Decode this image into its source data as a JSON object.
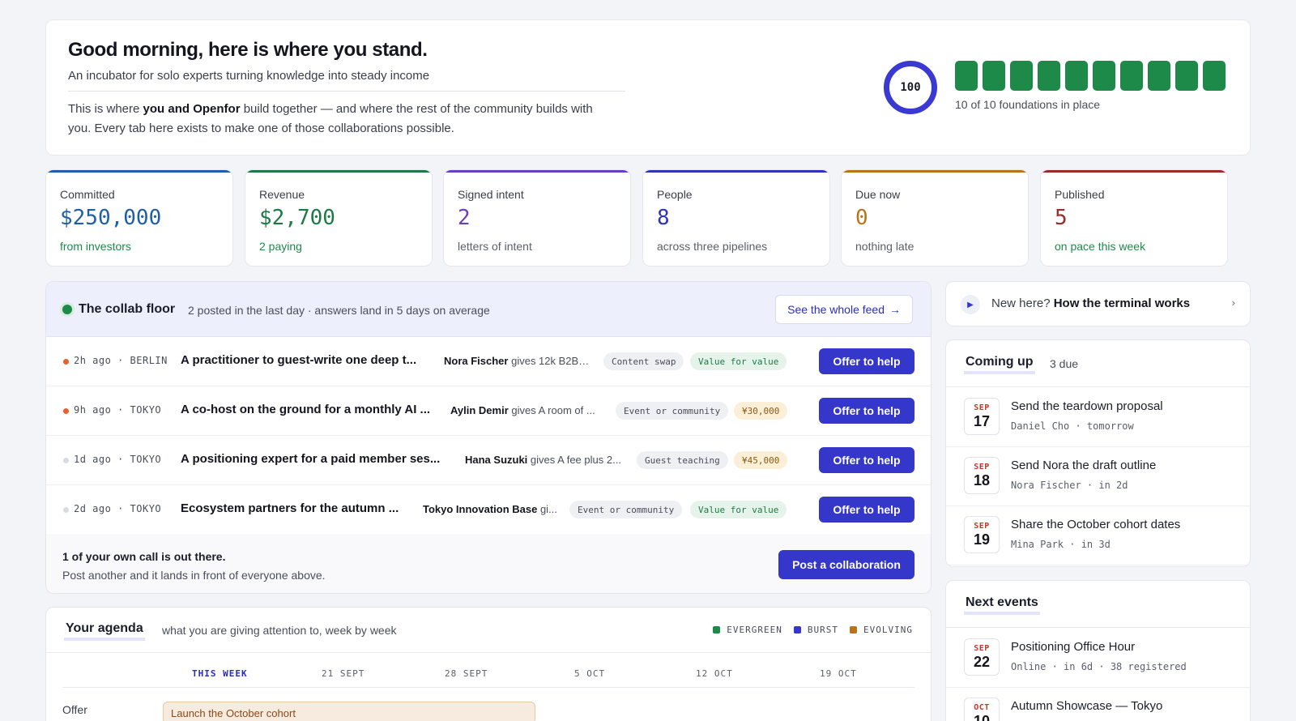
{
  "hero": {
    "title": "Good morning, here is where you stand.",
    "subtitle": "An incubator for solo experts turning knowledge into steady income",
    "body_pre": "This is where ",
    "body_bold": "you and Openfor",
    "body_post": " build together — and where the rest of the community builds with you. Every tab here exists to make one of those collaborations possible.",
    "score": "100",
    "foundations_done": 10,
    "foundations_total": 10,
    "foundations_caption": "10 of 10 foundations in place",
    "colors": {
      "ring": "#3a3ad2",
      "block": "#1e8a4a"
    }
  },
  "stats": [
    {
      "label": "Committed",
      "value": "$250,000",
      "sub": "from investors",
      "accent": "#1f5fa8",
      "sub_green": true
    },
    {
      "label": "Revenue",
      "value": "$2,700",
      "sub": "2 paying",
      "accent": "#1e7a44",
      "sub_green": true
    },
    {
      "label": "Signed intent",
      "value": "2",
      "sub": "letters of intent",
      "accent": "#6a3fbf",
      "sub_green": false
    },
    {
      "label": "People",
      "value": "8",
      "sub": "across three pipelines",
      "accent": "#2e35b8",
      "sub_green": false
    },
    {
      "label": "Due now",
      "value": "0",
      "sub": "nothing late",
      "accent": "#b8741a",
      "sub_green": false
    },
    {
      "label": "Published",
      "value": "5",
      "sub": "on pace this week",
      "accent": "#9b2c2c",
      "sub_green": true
    }
  ],
  "collab": {
    "title": "The collab floor",
    "meta": "2 posted in the last day · answers land in 5 days on average",
    "feed_button": "See the whole feed",
    "offer_label": "Offer to help",
    "rows": [
      {
        "time": "2h ago · BERLIN",
        "title": "A practitioner to guest-write one deep t...",
        "giver_name": "Nora Fischer",
        "giver_rest": " gives 12k B2B r...",
        "tag1": "Content swap",
        "tag2": "Value for value",
        "dot": "#e8602c"
      },
      {
        "time": "9h ago · TOKYO",
        "title": "A co-host on the ground for a monthly AI ...",
        "giver_name": "Aylin Demir",
        "giver_rest": " gives A room of ...",
        "tag1": "Event or community",
        "tag2": "¥30,000",
        "dot": "#e8602c"
      },
      {
        "time": "1d ago · TOKYO",
        "title": "A positioning expert for a paid member ses...",
        "giver_name": "Hana Suzuki",
        "giver_rest": " gives A fee plus 2...",
        "tag1": "Guest teaching",
        "tag2": "¥45,000",
        "dot": "#d9dbe3"
      },
      {
        "time": "2d ago · TOKYO",
        "title": "Ecosystem partners for the autumn ...",
        "giver_name": "Tokyo Innovation Base",
        "giver_rest": " gi...",
        "tag1": "Event or community",
        "tag2": "Value for value",
        "dot": "#d9dbe3"
      }
    ],
    "foot_title": "1 of your own call is out there.",
    "foot_sub": "Post another and it lands in front of everyone above.",
    "post_button": "Post a collaboration"
  },
  "agenda": {
    "title": "Your agenda",
    "subtitle": "what you are giving attention to, week by week",
    "legend": [
      {
        "label": "EVERGREEN",
        "color": "#1e8a4a"
      },
      {
        "label": "BURST",
        "color": "#3437c9"
      },
      {
        "label": "EVOLVING",
        "color": "#b8741a"
      }
    ],
    "weeks": [
      "THIS WEEK",
      "21 SEPT",
      "28 SEPT",
      "5 OCT",
      "12 OCT",
      "19 OCT"
    ],
    "lane_label": "Offer",
    "lane_item": "Launch the October cohort"
  },
  "howto": {
    "lead": "New here? ",
    "bold": "How the terminal works"
  },
  "coming_up": {
    "title": "Coming up",
    "count": "3 due",
    "items": [
      {
        "month": "SEP",
        "day": "17",
        "title": "Send the teardown proposal",
        "meta": "Daniel Cho · tomorrow"
      },
      {
        "month": "SEP",
        "day": "18",
        "title": "Send Nora the draft outline",
        "meta": "Nora Fischer · in 2d"
      },
      {
        "month": "SEP",
        "day": "19",
        "title": "Share the October cohort dates",
        "meta": "Mina Park · in 3d"
      }
    ]
  },
  "next_events": {
    "title": "Next events",
    "items": [
      {
        "month": "SEP",
        "day": "22",
        "title": "Positioning Office Hour",
        "meta": "Online · in 6d · 38 registered"
      },
      {
        "month": "OCT",
        "day": "10",
        "title": "Autumn Showcase — Tokyo",
        "meta": ""
      }
    ]
  }
}
